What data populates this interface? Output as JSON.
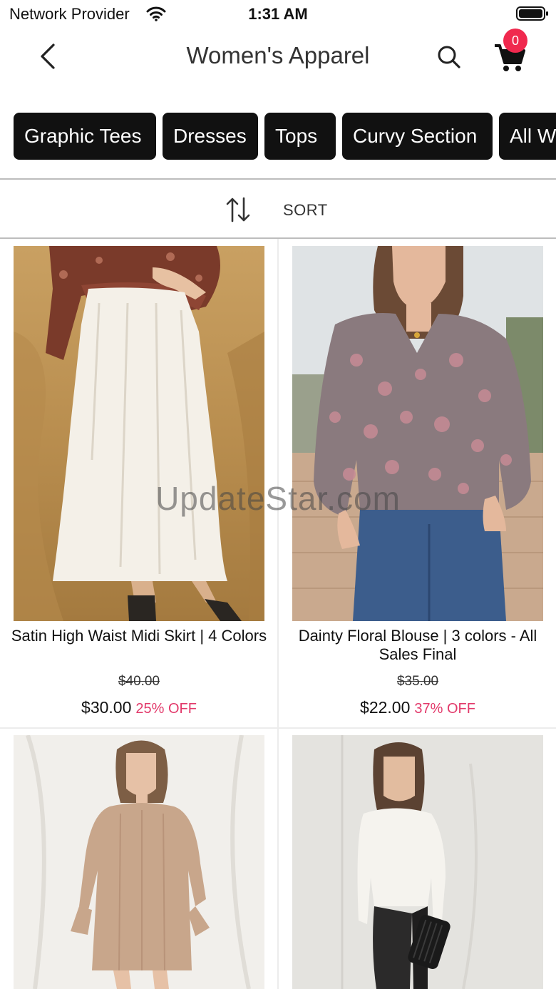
{
  "status_bar": {
    "carrier": "Network Provider",
    "time": "1:31 AM"
  },
  "header": {
    "title": "Women's Apparel",
    "cart_count": "0"
  },
  "categories": [
    "Graphic Tees",
    "Dresses",
    "Tops",
    "Curvy Section",
    "All W"
  ],
  "sort": {
    "label": "SORT"
  },
  "products": [
    {
      "name": "Satin High Waist Midi Skirt | 4 Colors",
      "original_price": "$40.00",
      "price": "$30.00",
      "discount": "25% OFF"
    },
    {
      "name": "Dainty Floral Blouse | 3 colors - All Sales Final",
      "original_price": "$35.00",
      "price": "$22.00",
      "discount": "37% OFF"
    },
    {},
    {}
  ],
  "watermark": "UpdateStar.com",
  "colors": {
    "chip_bg": "#111111",
    "badge": "#f0294e",
    "discount": "#e23a6b"
  }
}
